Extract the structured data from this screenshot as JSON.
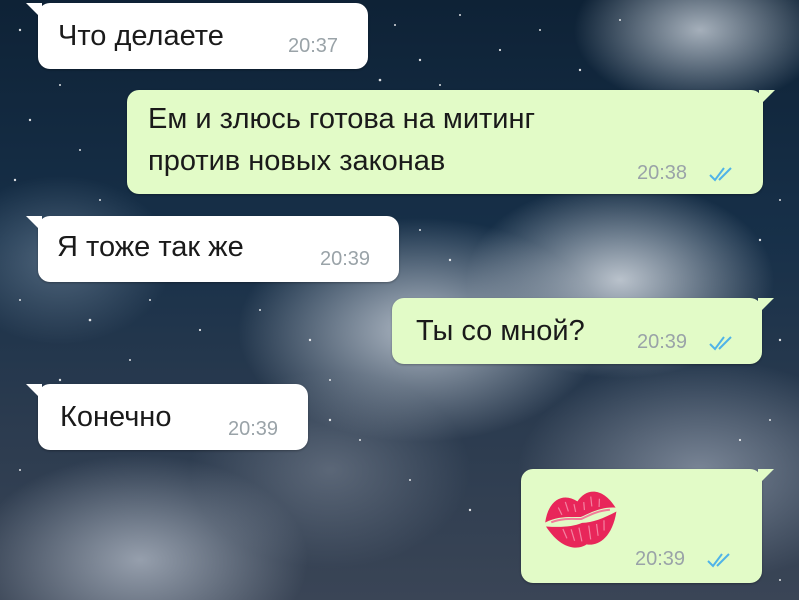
{
  "chat": {
    "messages": [
      {
        "direction": "incoming",
        "text": "Что делаете",
        "time": "20:37"
      },
      {
        "direction": "outgoing",
        "lines": [
          "Ем и злюсь готова на митинг",
          "против новых законав"
        ],
        "time": "20:38",
        "status": "read"
      },
      {
        "direction": "incoming",
        "text": "Я тоже так же",
        "time": "20:39"
      },
      {
        "direction": "outgoing",
        "text": "Ты со мной?",
        "time": "20:39",
        "status": "read"
      },
      {
        "direction": "incoming",
        "text": "Конечно",
        "time": "20:39"
      },
      {
        "direction": "outgoing",
        "sticker": "lips-kiss-icon",
        "time": "20:39",
        "status": "read"
      }
    ]
  },
  "colors": {
    "incoming_bubble": "#ffffff",
    "outgoing_bubble": "#e2fbc7",
    "read_ticks": "#4fb3e8",
    "timestamp": "#9aa3a8",
    "kiss": "#e8265a"
  }
}
